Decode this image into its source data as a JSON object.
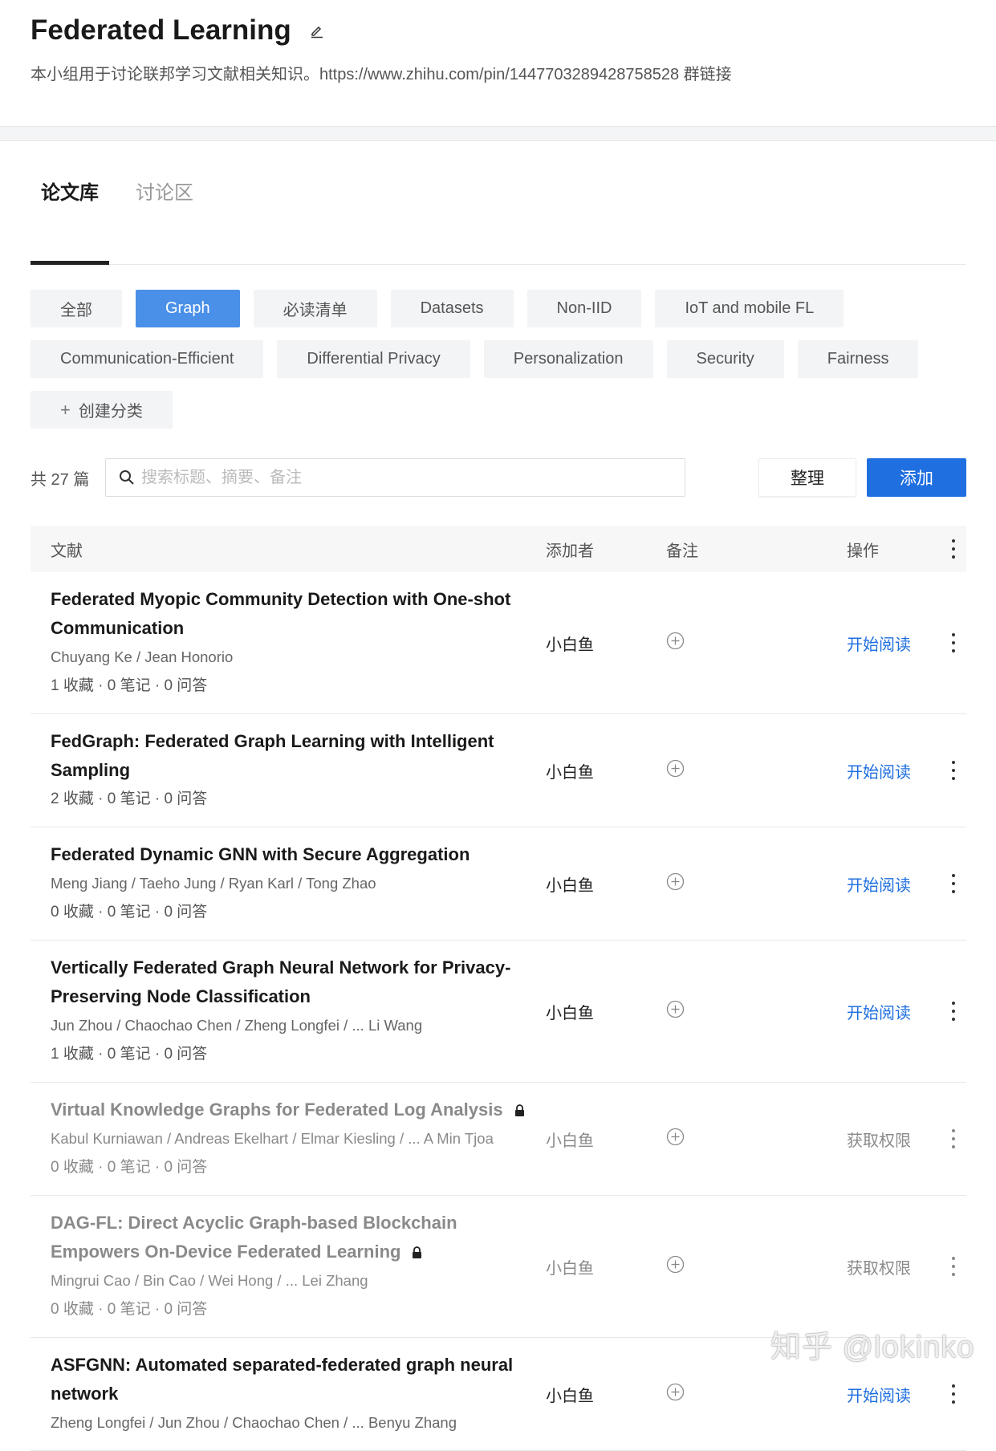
{
  "header": {
    "title": "Federated Learning",
    "description": "本小组用于讨论联邦学习文献相关知识。https://www.zhihu.com/pin/1447703289428758528 群链接"
  },
  "tabs": [
    {
      "label": "论文库",
      "active": true
    },
    {
      "label": "讨论区",
      "active": false
    }
  ],
  "chips": [
    "全部",
    "Graph",
    "必读清单",
    "Datasets",
    "Non-IID",
    "IoT and mobile FL",
    "Communication-Efficient",
    "Differential Privacy",
    "Personalization",
    "Security",
    "Fairness"
  ],
  "active_chip": "Graph",
  "create_chip": "创建分类",
  "toolbar": {
    "count": "共 27 篇",
    "search_placeholder": "搜索标题、摘要、备注",
    "organize": "整理",
    "add": "添加"
  },
  "table": {
    "headers": {
      "paper": "文献",
      "adder": "添加者",
      "note": "备注",
      "action": "操作"
    }
  },
  "rows": [
    {
      "title": "Federated Myopic Community Detection with One-shot Communication",
      "authors": "Chuyang Ke / Jean Honorio",
      "stats": "1 收藏 · 0 笔记 · 0 问答",
      "adder": "小白鱼",
      "action": "开始阅读",
      "locked": false
    },
    {
      "title": "FedGraph: Federated Graph Learning with Intelligent Sampling",
      "authors": "",
      "stats": "2 收藏 · 0 笔记 · 0 问答",
      "adder": "小白鱼",
      "action": "开始阅读",
      "locked": false
    },
    {
      "title": "Federated Dynamic GNN with Secure Aggregation",
      "authors": "Meng Jiang / Taeho Jung / Ryan Karl / Tong Zhao",
      "stats": "0 收藏 · 0 笔记 · 0 问答",
      "adder": "小白鱼",
      "action": "开始阅读",
      "locked": false
    },
    {
      "title": "Vertically Federated Graph Neural Network for Privacy-Preserving Node Classification",
      "authors": "Jun Zhou / Chaochao Chen / Zheng Longfei / ... Li Wang",
      "stats": "1 收藏 · 0 笔记 · 0 问答",
      "adder": "小白鱼",
      "action": "开始阅读",
      "locked": false
    },
    {
      "title": "Virtual Knowledge Graphs for Federated Log Analysis",
      "authors": "Kabul Kurniawan / Andreas Ekelhart / Elmar Kiesling / ... A Min Tjoa",
      "stats": "0 收藏 · 0 笔记 · 0 问答",
      "adder": "小白鱼",
      "action": "获取权限",
      "locked": true
    },
    {
      "title": "DAG-FL: Direct Acyclic Graph-based Blockchain Empowers On-Device Federated Learning",
      "authors": "Mingrui Cao / Bin Cao / Wei Hong / ... Lei Zhang",
      "stats": "0 收藏 · 0 笔记 · 0 问答",
      "adder": "小白鱼",
      "action": "获取权限",
      "locked": true
    },
    {
      "title": "ASFGNN: Automated separated-federated graph neural network",
      "authors": "Zheng Longfei / Jun Zhou / Chaochao Chen / ... Benyu Zhang",
      "stats": "",
      "adder": "小白鱼",
      "action": "开始阅读",
      "locked": false
    }
  ],
  "watermark": "知乎 @lokinko",
  "colors": {
    "accent": "#1f6fe0",
    "chip_active": "#4a90e8"
  }
}
